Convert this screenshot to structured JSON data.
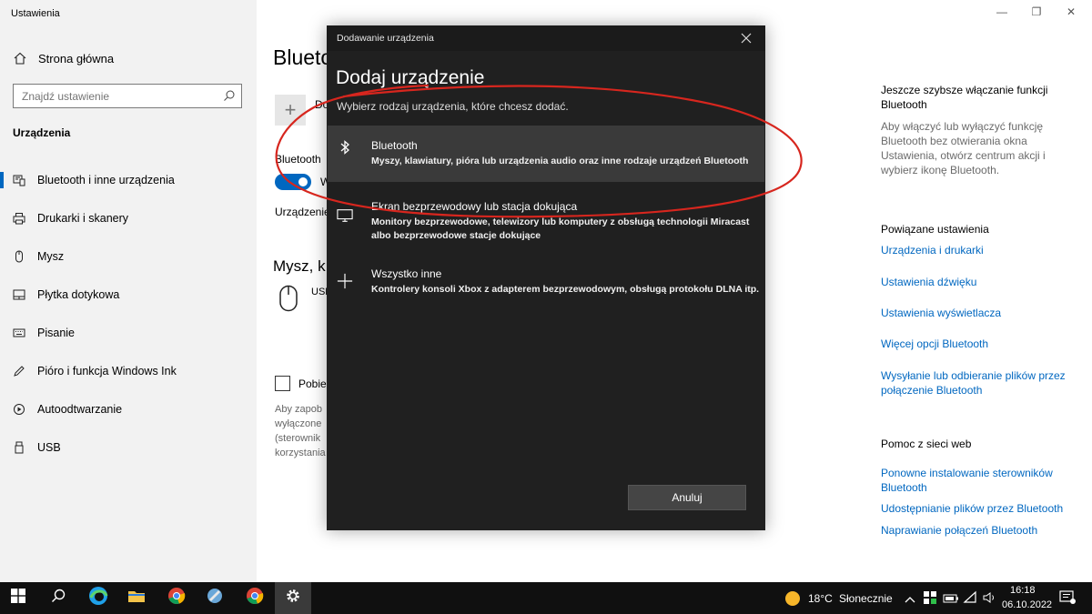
{
  "window": {
    "title": "Ustawienia",
    "minimize": "—",
    "maximize": "❐",
    "close": "✕"
  },
  "sidebar": {
    "home_label": "Strona główna",
    "search_placeholder": "Znajdź ustawienie",
    "section": "Urządzenia",
    "items": [
      {
        "label": "Bluetooth i inne urządzenia",
        "icon": "bluetooth-devices-icon",
        "active": true
      },
      {
        "label": "Drukarki i skanery",
        "icon": "printer-icon"
      },
      {
        "label": "Mysz",
        "icon": "mouse-icon"
      },
      {
        "label": "Płytka dotykowa",
        "icon": "touchpad-icon"
      },
      {
        "label": "Pisanie",
        "icon": "keyboard-icon"
      },
      {
        "label": "Pióro i funkcja Windows Ink",
        "icon": "pen-icon"
      },
      {
        "label": "Autoodtwarzanie",
        "icon": "autoplay-icon"
      },
      {
        "label": "USB",
        "icon": "usb-icon"
      }
    ]
  },
  "main": {
    "title": "Blueto",
    "add_label": "Do",
    "bt_label": "Bluetooth",
    "toggle_text": "W",
    "devices_text": "Urządzenie",
    "mouse_heading": "Mysz, k",
    "usb_text": "USE",
    "checkbox_label": "Pobie",
    "note_lines": [
      "Aby zapob",
      "wyłączone",
      "(sterownik",
      "korzystania"
    ]
  },
  "related": {
    "quick_heading": "Jeszcze szybsze włączanie funkcji Bluetooth",
    "quick_text": "Aby włączyć lub wyłączyć funkcję Bluetooth bez otwierania okna Ustawienia, otwórz centrum akcji i wybierz ikonę Bluetooth.",
    "related_heading": "Powiązane ustawienia",
    "related_links": [
      "Urządzenia i drukarki",
      "Ustawienia dźwięku",
      "Ustawienia wyświetlacza",
      "Więcej opcji Bluetooth",
      "Wysyłanie lub odbieranie plików przez połączenie Bluetooth"
    ],
    "web_heading": "Pomoc z sieci web",
    "web_links": [
      "Ponowne instalowanie sterowników Bluetooth",
      "Udostępnianie plików przez Bluetooth",
      "Naprawianie połączeń Bluetooth"
    ]
  },
  "dialog": {
    "titlebar": "Dodawanie urządzenia",
    "heading": "Dodaj urządzenie",
    "subtitle": "Wybierz rodzaj urządzenia, które chcesz dodać.",
    "options": [
      {
        "title": "Bluetooth",
        "desc": "Myszy, klawiatury, pióra lub urządzenia audio oraz inne rodzaje urządzeń Bluetooth",
        "icon": "bluetooth-icon"
      },
      {
        "title": "Ekran bezprzewodowy lub stacja dokująca",
        "desc": "Monitory bezprzewodowe, telewizory lub komputery z obsługą technologii Miracast albo bezprzewodowe stacje dokujące",
        "icon": "monitor-icon"
      },
      {
        "title": "Wszystko inne",
        "desc": "Kontrolery konsoli Xbox z adapterem bezprzewodowym, obsługą protokołu DLNA itp.",
        "icon": "plus-icon"
      }
    ],
    "cancel_label": "Anuluj"
  },
  "taskbar": {
    "weather_temp": "18°C",
    "weather_text": "Słonecznie",
    "time": "16:18",
    "date": "06.10.2022",
    "colors": {
      "bg": "#101010",
      "active": "#3a3a3a"
    }
  }
}
